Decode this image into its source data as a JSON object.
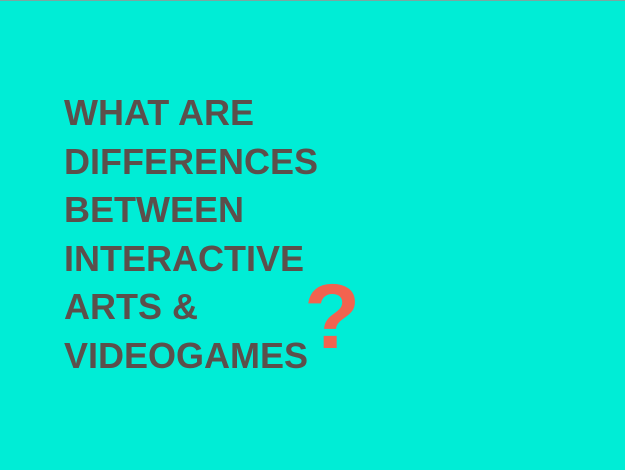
{
  "slide": {
    "headline_lines": [
      "WHAT ARE",
      "DIFFERENCES",
      "BETWEEN",
      "INTERACTIVE",
      "ARTS &",
      "VIDEOGAMES"
    ],
    "question_mark": "?",
    "colors": {
      "background": "#00EDD6",
      "text": "#5C4F4B",
      "accent": "#F2634F"
    }
  }
}
